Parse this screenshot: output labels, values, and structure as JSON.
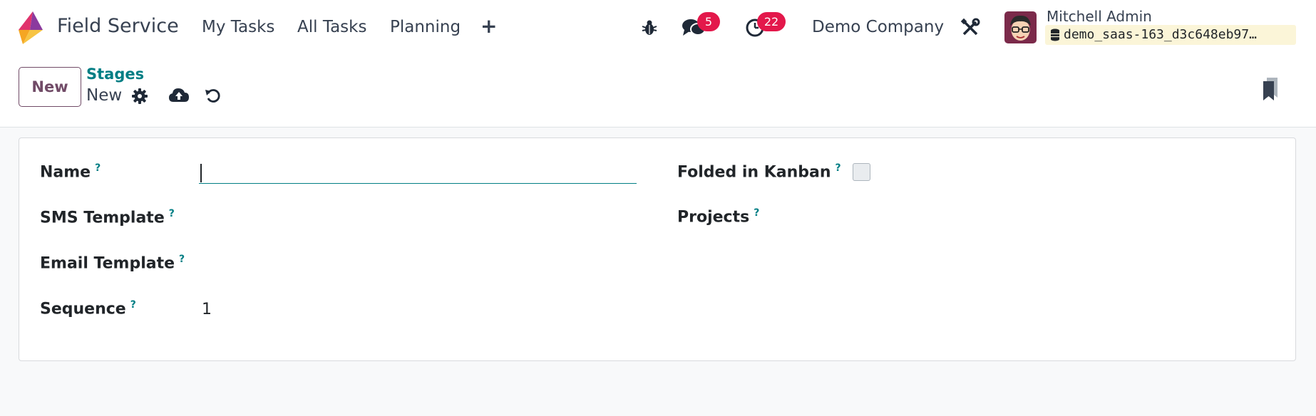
{
  "navbar": {
    "app_name": "Field Service",
    "menu": [
      "My Tasks",
      "All Tasks",
      "Planning"
    ],
    "plus": "+",
    "messages_count": "5",
    "activities_count": "22",
    "company": "Demo Company",
    "user_name": "Mitchell Admin",
    "database": "demo_saas-163_d3c648eb97…"
  },
  "control_panel": {
    "new_button": "New",
    "breadcrumb_parent": "Stages",
    "breadcrumb_current": "New"
  },
  "form": {
    "name_label": "Name",
    "name_value": "",
    "sms_label": "SMS Template",
    "email_label": "Email Template",
    "sequence_label": "Sequence",
    "sequence_value": "1",
    "folded_label": "Folded in Kanban",
    "projects_label": "Projects",
    "help_mark": "?"
  },
  "colors": {
    "brand": "#714b67",
    "accent": "#017e84",
    "badge": "#e3184b"
  },
  "icons": [
    "field-service-logo",
    "bug-icon",
    "chat-icon",
    "clock-icon",
    "tools-icon",
    "gear-icon",
    "cloud-upload-icon",
    "undo-icon",
    "bookmark-icon",
    "database-icon"
  ]
}
